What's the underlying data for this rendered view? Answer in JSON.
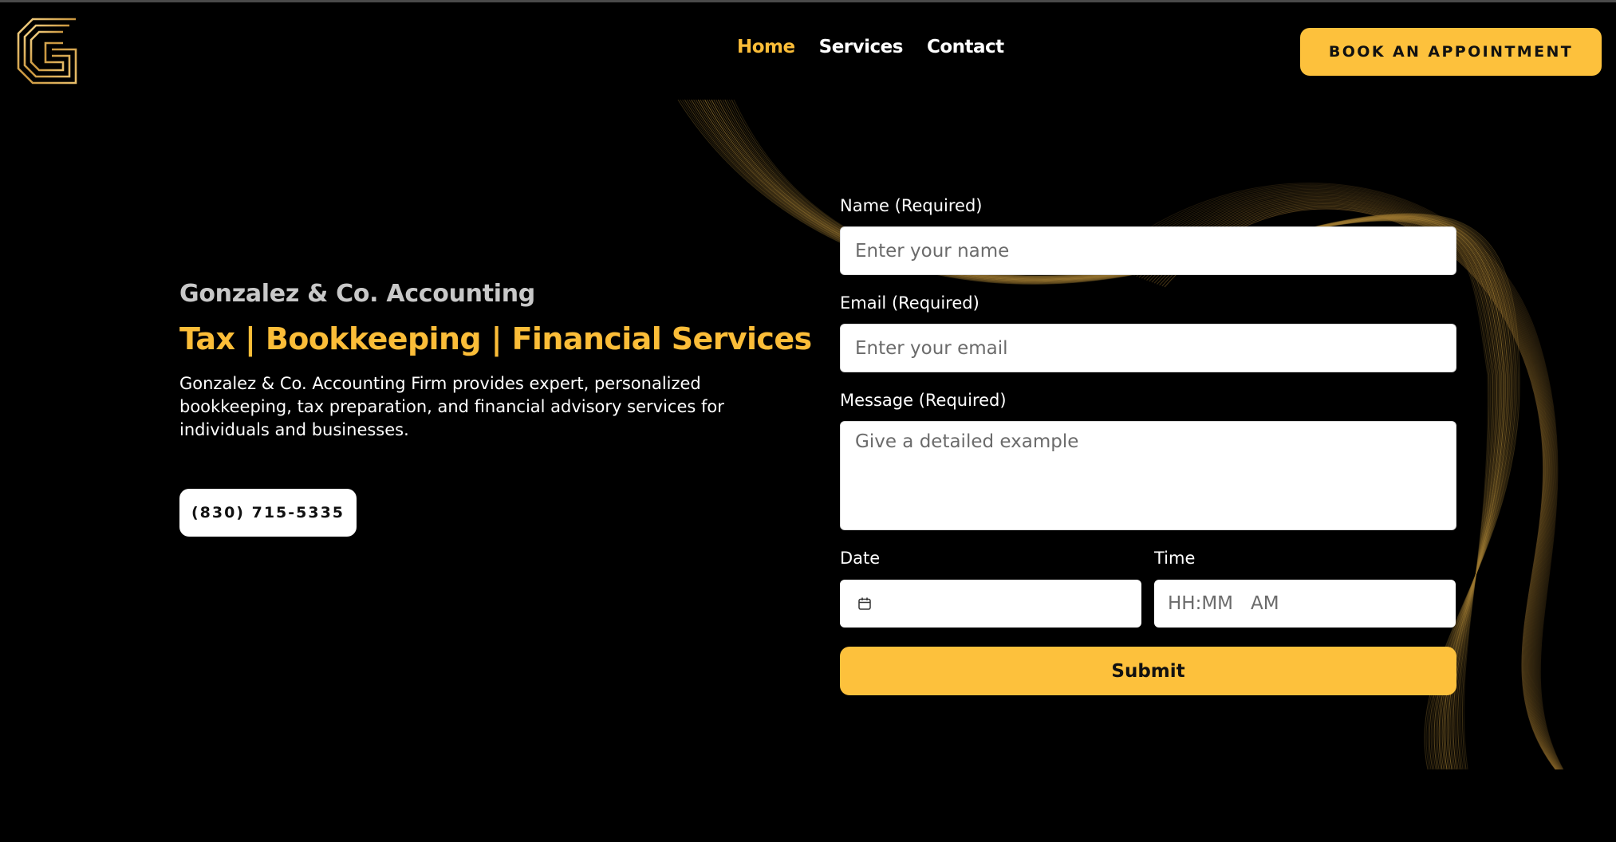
{
  "header": {
    "logo_icon": "gonzalez-g-logo-icon",
    "nav": [
      {
        "label": "Home",
        "active": true
      },
      {
        "label": "Services",
        "active": false
      },
      {
        "label": "Contact",
        "active": false
      }
    ],
    "book_button": "BOOK AN APPOINTMENT"
  },
  "hero": {
    "company": "Gonzalez & Co. Accounting",
    "tagline": "Tax | Bookkeeping | Financial Services",
    "description": "Gonzalez & Co. Accounting Firm provides expert, personalized bookkeeping, tax preparation, and financial advisory services for individuals and businesses.",
    "phone": "(830) 715-5335"
  },
  "form": {
    "name_label": "Name (Required)",
    "name_placeholder": "Enter your name",
    "email_label": "Email (Required)",
    "email_placeholder": "Enter your email",
    "message_label": "Message (Required)",
    "message_placeholder": "Give a detailed example",
    "date_label": "Date",
    "date_icon": "calendar-icon",
    "time_label": "Time",
    "time_hours_minutes": "HH:MM",
    "time_period": "AM",
    "submit": "Submit"
  },
  "colors": {
    "background": "#000000",
    "accent": "#fbbd38",
    "button": "#fdc13c",
    "heading_gray": "#c8c8c8",
    "white": "#ffffff"
  }
}
